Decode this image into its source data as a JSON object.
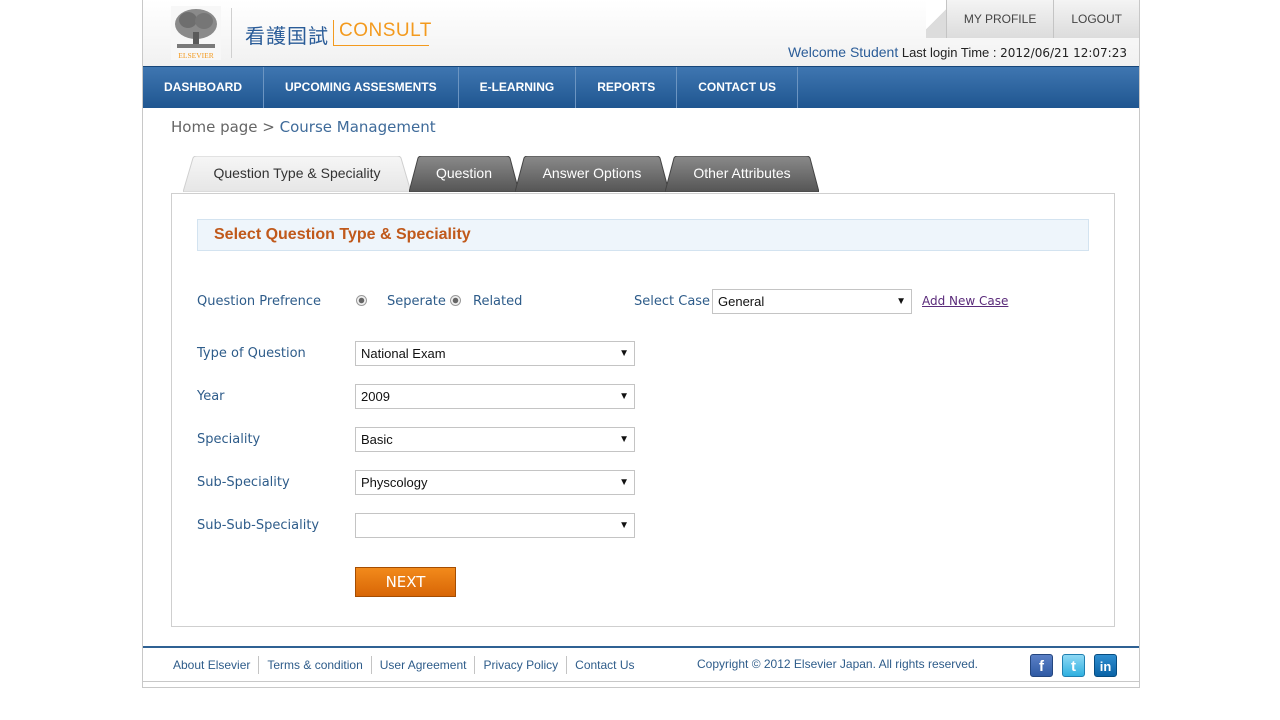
{
  "header": {
    "logo_caption": "ELSEVIER",
    "brand_jp": "看護国試",
    "brand_en": "CONSULT",
    "top_links": [
      "MY PROFILE",
      "LOGOUT"
    ],
    "welcome_label": "Welcome Student",
    "last_login_label": "Last login Time :",
    "last_login_time": "2012/06/21 12:07:23"
  },
  "nav": {
    "items": [
      "DASHBOARD",
      "UPCOMING ASSESMENTS",
      "E-LEARNING",
      "REPORTS",
      "CONTACT US"
    ]
  },
  "breadcrumb": {
    "home": "Home page",
    "separator": " > ",
    "current": "Course Management"
  },
  "tabs": [
    {
      "label": "Question Type & Speciality",
      "active": true
    },
    {
      "label": "Question",
      "active": false
    },
    {
      "label": "Answer Options",
      "active": false
    },
    {
      "label": "Other Attributes",
      "active": false
    }
  ],
  "form": {
    "title": "Select Question Type & Speciality",
    "question_preference_label": "Question Prefrence",
    "radio_options": [
      "Seperate",
      "Related"
    ],
    "select_case_label": "Select Case",
    "select_case_value": "General",
    "add_case_link": "Add New Case",
    "type_label": "Type of Question",
    "type_value": "National Exam",
    "year_label": "Year",
    "year_value": "2009",
    "speciality_label": "Speciality",
    "speciality_value": "Basic",
    "sub_speciality_label": "Sub-Speciality",
    "sub_speciality_value": "Physcology",
    "sub_sub_speciality_label": "Sub-Sub-Speciality",
    "sub_sub_speciality_value": "",
    "next_label": "NEXT"
  },
  "footer": {
    "links": [
      "About Elsevier",
      "Terms & condition",
      "User Agreement",
      "Privacy Policy",
      "Contact Us"
    ],
    "copyright": "Copyright © 2012 Elsevier Japan. All rights reserved.",
    "social": [
      "f",
      "t",
      "in"
    ]
  },
  "colors": {
    "nav_blue": "#2a5f99",
    "accent_orange": "#e0720c",
    "title_orange": "#c0591b",
    "link_blue": "#2e5c8a"
  }
}
